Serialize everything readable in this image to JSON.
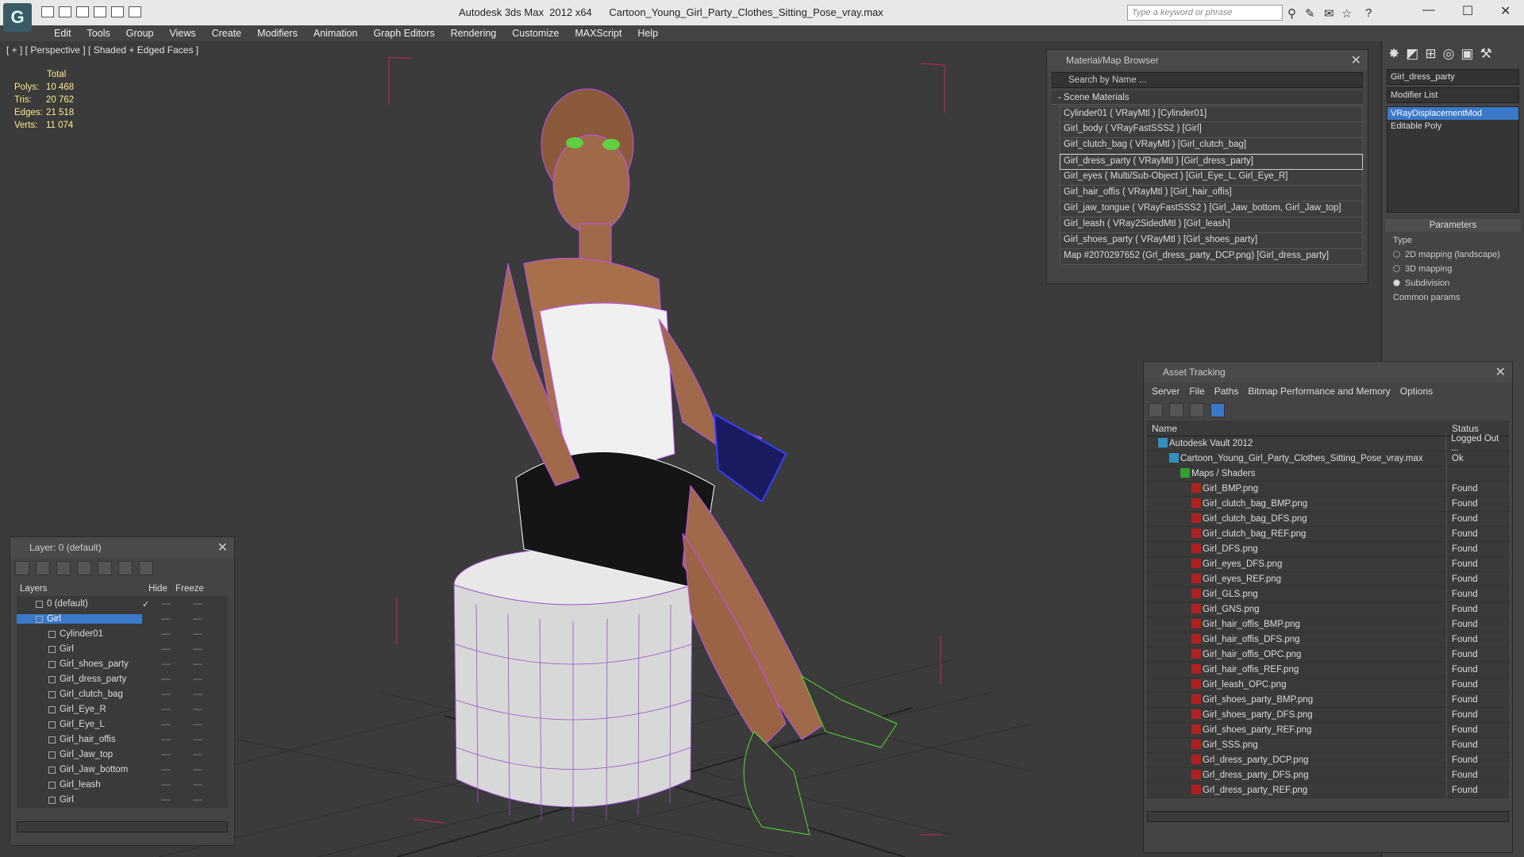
{
  "app": {
    "title": "Autodesk 3ds Max  2012 x64      Cartoon_Young_Girl_Party_Clothes_Sitting_Pose_vray.max",
    "search_placeholder": "Type a keyword or phrase",
    "logo": "logo-icon"
  },
  "menu": [
    "Edit",
    "Tools",
    "Group",
    "Views",
    "Create",
    "Modifiers",
    "Animation",
    "Graph Editors",
    "Rendering",
    "Customize",
    "MAXScript",
    "Help"
  ],
  "viewport": {
    "label": "[ + ] [ Perspective ] [ Shaded + Edged Faces ]",
    "stats": {
      "header": "Total",
      "rows": [
        {
          "k": "Polys:",
          "v": "10 468"
        },
        {
          "k": "Tris:",
          "v": "20 762"
        },
        {
          "k": "Edges:",
          "v": "21 518"
        },
        {
          "k": "Verts:",
          "v": "11 074"
        }
      ]
    }
  },
  "material_browser": {
    "title": "Material/Map Browser",
    "search": "Search by Name ...",
    "section": "- Scene Materials",
    "items": [
      "Cylinder01  ( VRayMtl )  [Cylinder01]",
      "Girl_body  ( VRayFastSSS2 )  [Girl]",
      "Girl_clutch_bag  ( VRayMtl )  [Girl_clutch_bag]",
      "Girl_dress_party  ( VRayMtl )  [Girl_dress_party]",
      "Girl_eyes  ( Multi/Sub-Object )  [Girl_Eye_L, Girl_Eye_R]",
      "Girl_hair_offis  ( VRayMtl )  [Girl_hair_offis]",
      "Girl_jaw_tongue  ( VRayFastSSS2 )  [Girl_Jaw_bottom, Girl_Jaw_top]",
      "Girl_leash  ( VRay2SidedMtl )  [Girl_leash]",
      "Girl_shoes_party  ( VRayMtl )  [Girl_shoes_party]",
      "Map #2070297652 (Grl_dress_party_DCP.png) [Girl_dress_party]"
    ]
  },
  "command_panel": {
    "object_name": "Girl_dress_party",
    "modifier_list": "Modifier List",
    "stack": [
      "VRayDisplacementMod",
      "Editable Poly"
    ],
    "params_title": "Parameters",
    "type_label": "Type",
    "options": [
      "2D mapping (landscape)",
      "3D mapping",
      "Subdivision"
    ],
    "common": "Common params"
  },
  "asset_tracking": {
    "title": "Asset Tracking",
    "menu": [
      "Server",
      "File",
      "Paths",
      "Bitmap Performance and Memory",
      "Options"
    ],
    "col_name": "Name",
    "col_status": "Status",
    "rows": [
      {
        "name": "Autodesk Vault 2012",
        "status": "Logged Out ...",
        "indent": 1,
        "icon": "vault-icon"
      },
      {
        "name": "Cartoon_Young_Girl_Party_Clothes_Sitting_Pose_vray.max",
        "status": "Ok",
        "indent": 2,
        "icon": "max-file-icon"
      },
      {
        "name": "Maps / Shaders",
        "status": "",
        "indent": 3,
        "icon": "maps-folder-icon"
      },
      {
        "name": "Girl_BMP.png",
        "status": "Found",
        "indent": 4,
        "icon": "png-icon"
      },
      {
        "name": "Girl_clutch_bag_BMP.png",
        "status": "Found",
        "indent": 4,
        "icon": "png-icon"
      },
      {
        "name": "Girl_clutch_bag_DFS.png",
        "status": "Found",
        "indent": 4,
        "icon": "png-icon"
      },
      {
        "name": "Girl_clutch_bag_REF.png",
        "status": "Found",
        "indent": 4,
        "icon": "png-icon"
      },
      {
        "name": "Girl_DFS.png",
        "status": "Found",
        "indent": 4,
        "icon": "png-icon"
      },
      {
        "name": "Girl_eyes_DFS.png",
        "status": "Found",
        "indent": 4,
        "icon": "png-icon"
      },
      {
        "name": "Girl_eyes_REF.png",
        "status": "Found",
        "indent": 4,
        "icon": "png-icon"
      },
      {
        "name": "Girl_GLS.png",
        "status": "Found",
        "indent": 4,
        "icon": "png-icon"
      },
      {
        "name": "Girl_GNS.png",
        "status": "Found",
        "indent": 4,
        "icon": "png-icon"
      },
      {
        "name": "Girl_hair_offis_BMP.png",
        "status": "Found",
        "indent": 4,
        "icon": "png-icon"
      },
      {
        "name": "Girl_hair_offis_DFS.png",
        "status": "Found",
        "indent": 4,
        "icon": "png-icon"
      },
      {
        "name": "Girl_hair_offis_OPC.png",
        "status": "Found",
        "indent": 4,
        "icon": "png-icon"
      },
      {
        "name": "Girl_hair_offis_REF.png",
        "status": "Found",
        "indent": 4,
        "icon": "png-icon"
      },
      {
        "name": "Girl_leash_OPC.png",
        "status": "Found",
        "indent": 4,
        "icon": "png-icon"
      },
      {
        "name": "Girl_shoes_party_BMP.png",
        "status": "Found",
        "indent": 4,
        "icon": "png-icon"
      },
      {
        "name": "Girl_shoes_party_DFS.png",
        "status": "Found",
        "indent": 4,
        "icon": "png-icon"
      },
      {
        "name": "Girl_shoes_party_REF.png",
        "status": "Found",
        "indent": 4,
        "icon": "png-icon"
      },
      {
        "name": "Girl_SSS.png",
        "status": "Found",
        "indent": 4,
        "icon": "png-icon"
      },
      {
        "name": "Grl_dress_party_DCP.png",
        "status": "Found",
        "indent": 4,
        "icon": "png-icon"
      },
      {
        "name": "Grl_dress_party_DFS.png",
        "status": "Found",
        "indent": 4,
        "icon": "png-icon"
      },
      {
        "name": "Grl_dress_party_REF.png",
        "status": "Found",
        "indent": 4,
        "icon": "png-icon"
      }
    ]
  },
  "layers": {
    "title": "Layer: 0 (default)",
    "col_layers": "Layers",
    "col_hide": "Hide",
    "col_freeze": "Freeze",
    "rows": [
      {
        "name": "0 (default)",
        "indent": 1,
        "check": "✓",
        "sel": false
      },
      {
        "name": "Girl",
        "indent": 1,
        "check": "",
        "sel": true
      },
      {
        "name": "Cylinder01",
        "indent": 2,
        "check": "",
        "sel": false
      },
      {
        "name": "Girl",
        "indent": 2,
        "check": "",
        "sel": false
      },
      {
        "name": "Girl_shoes_party",
        "indent": 2,
        "check": "",
        "sel": false
      },
      {
        "name": "Girl_dress_party",
        "indent": 2,
        "check": "",
        "sel": false
      },
      {
        "name": "Girl_clutch_bag",
        "indent": 2,
        "check": "",
        "sel": false
      },
      {
        "name": "Girl_Eye_R",
        "indent": 2,
        "check": "",
        "sel": false
      },
      {
        "name": "Girl_Eye_L",
        "indent": 2,
        "check": "",
        "sel": false
      },
      {
        "name": "Girl_hair_offis",
        "indent": 2,
        "check": "",
        "sel": false
      },
      {
        "name": "Girl_Jaw_top",
        "indent": 2,
        "check": "",
        "sel": false
      },
      {
        "name": "Girl_Jaw_bottom",
        "indent": 2,
        "check": "",
        "sel": false
      },
      {
        "name": "Girl_leash",
        "indent": 2,
        "check": "",
        "sel": false
      },
      {
        "name": "Girl",
        "indent": 2,
        "check": "",
        "sel": false
      }
    ]
  },
  "colors": {
    "accent": "#3b78c8",
    "stats": "#ffeb8c",
    "wire": "#b040ff"
  }
}
